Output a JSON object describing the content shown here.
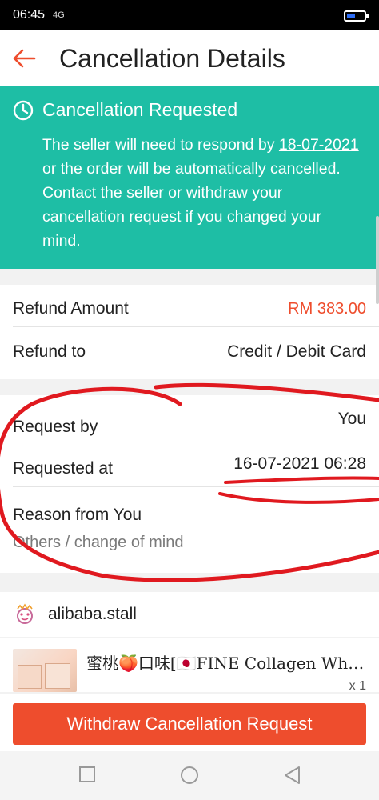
{
  "status_bar": {
    "time": "06:45",
    "signal": "4G"
  },
  "header": {
    "title": "Cancellation Details",
    "back_icon": "arrow-left-icon"
  },
  "banner": {
    "title": "Cancellation Requested",
    "icon": "clock-icon",
    "body_pre": "The seller will need to respond by ",
    "body_date": "18-07-2021",
    "body_post": " or the order will be automatically cancelled. Contact the seller or withdraw your cancellation request if you changed your mind."
  },
  "refund": {
    "amount_label": "Refund Amount",
    "amount_value": "RM 383.00",
    "to_label": "Refund to",
    "to_value": "Credit / Debit Card"
  },
  "request": {
    "by_label": "Request by",
    "by_value": "You",
    "at_label": "Requested at",
    "at_value": "16-07-2021 06:28",
    "reason_label": "Reason from You",
    "reason_value": "Others / change of mind"
  },
  "shop": {
    "name": "alibaba.stall"
  },
  "product": {
    "name": "蜜桃🍑口味[🇯🇵FINE Collagen White]",
    "qty": "x 1"
  },
  "actions": {
    "withdraw_label": "Withdraw Cancellation Request"
  },
  "colors": {
    "accent": "#ee4d2d",
    "banner": "#1ebea5",
    "annotation": "#e0191f"
  }
}
